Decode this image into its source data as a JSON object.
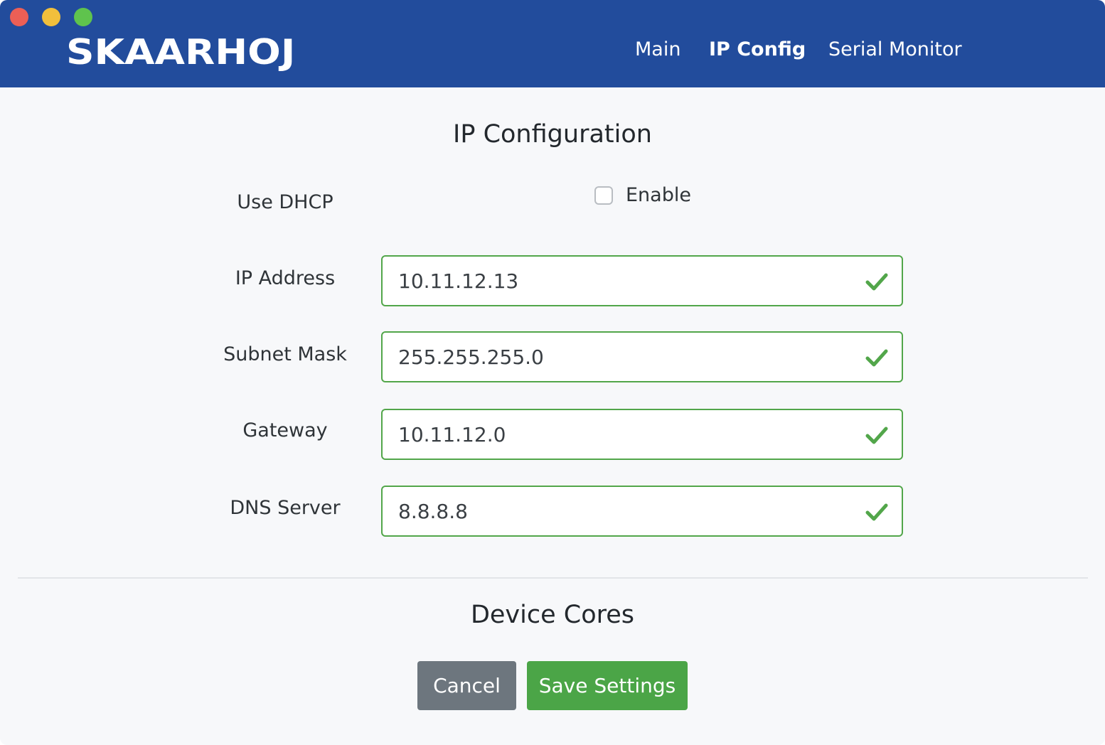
{
  "header": {
    "logo_text": "SKAARHOJ",
    "nav": [
      {
        "label": "Main",
        "active": false
      },
      {
        "label": "IP Config",
        "active": true
      },
      {
        "label": "Serial Monitor",
        "active": false
      }
    ],
    "colors": {
      "background": "#224c9c",
      "text": "#ffffff"
    }
  },
  "window_controls": [
    "close",
    "minimize",
    "zoom"
  ],
  "ip_config": {
    "title": "IP Configuration",
    "dhcp": {
      "label": "Use DHCP",
      "checkbox_label": "Enable",
      "checked": false
    },
    "fields": [
      {
        "label": "IP Address",
        "value": "10.11.12.13",
        "valid": true
      },
      {
        "label": "Subnet Mask",
        "value": "255.255.255.0",
        "valid": true
      },
      {
        "label": "Gateway",
        "value": "10.11.12.0",
        "valid": true
      },
      {
        "label": "DNS Server",
        "value": "8.8.8.8",
        "valid": true
      }
    ],
    "valid_color": "#52a64a"
  },
  "device_cores": {
    "title": "Device Cores"
  },
  "actions": {
    "cancel_label": "Cancel",
    "save_label": "Save Settings",
    "cancel_color": "#6d767e",
    "save_color": "#4ba547"
  }
}
